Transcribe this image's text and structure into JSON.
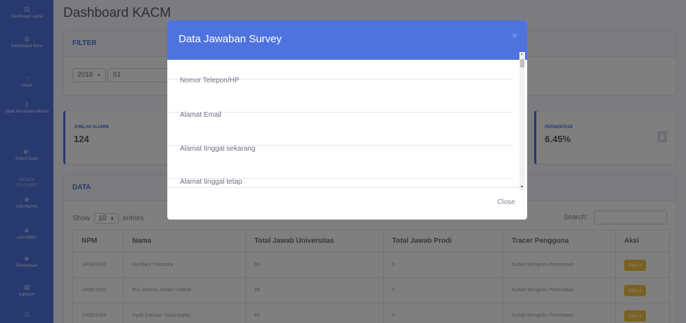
{
  "sidebar": {
    "items": [
      {
        "icon": "dashboard-icon",
        "glyph": "▤",
        "label": "Dashboard Lama"
      },
      {
        "icon": "dashboard-icon",
        "glyph": "◍",
        "label": "Dashboard Baru"
      },
      {
        "icon": "chart-icon",
        "glyph": "◔",
        "label": "Chart"
      },
      {
        "icon": "key-icon",
        "glyph": "⚷",
        "label": "Ubah Password Alumni"
      },
      {
        "icon": "export-icon",
        "glyph": "▶",
        "label": "Export Data"
      },
      {
        "icon": "",
        "glyph": "",
        "label": "HIDDEN FEATURES"
      },
      {
        "icon": "user-check-icon",
        "glyph": "◉",
        "label": "Cek Alumni"
      },
      {
        "icon": "user-icon",
        "glyph": "♟",
        "label": "List Admin"
      },
      {
        "icon": "question-icon",
        "glyph": "◆",
        "label": "Pertanyaan"
      },
      {
        "icon": "category-icon",
        "glyph": "▦",
        "label": "Kategori"
      },
      {
        "icon": "list-icon",
        "glyph": "☰",
        "label": ""
      }
    ]
  },
  "page": {
    "title": "Dashboard KACM"
  },
  "filter": {
    "header": "FILTER",
    "year": "2018",
    "year_caret": "▾",
    "level": "S1"
  },
  "stats": {
    "jumlah_label": "JUMLAH ALUMNI",
    "jumlah_value": "124",
    "persen_label": "PERSENTASE",
    "persen_value": "6.45%",
    "persen_icon": "clipboard-icon"
  },
  "data_section": {
    "header": "DATA",
    "show_label": "Show",
    "entries_value": "10",
    "entries_caret": "⬍",
    "entries_label": "entries",
    "search_label": "Search:"
  },
  "table": {
    "headers": [
      "NPM",
      "Nama",
      "Total Jawab Universitas",
      "Total Jawab Prodi",
      "Tracer Pengguna",
      "Aksi"
    ],
    "rows": [
      {
        "npm": "140801482",
        "nama": "Aprilliani Theodora",
        "univ": "66",
        "prodi": "6",
        "tracer": "Sudah Mengirim Permintaan",
        "aksi": "Aksi ▾"
      },
      {
        "npm": "140801533",
        "nama": "Rivi Jeremy Jordan Umboh",
        "univ": "66",
        "prodi": "6",
        "tracer": "Sudah Mengirim Permintaan",
        "aksi": "Aksi ▾"
      },
      {
        "npm": "140801495",
        "nama": "Dyah Carinae Yalapraspita",
        "univ": "65",
        "prodi": "6",
        "tracer": "Sudah Mengirim Permintaan",
        "aksi": "Aksi ▾"
      }
    ]
  },
  "modal": {
    "title": "Data Jawaban Survey",
    "close_x": "×",
    "items": [
      "Nomor Telepon/HP",
      "Alamat Email",
      "Alamat tinggal sekarang",
      "Alamat tinggal tetap"
    ],
    "close_button": "Close"
  }
}
